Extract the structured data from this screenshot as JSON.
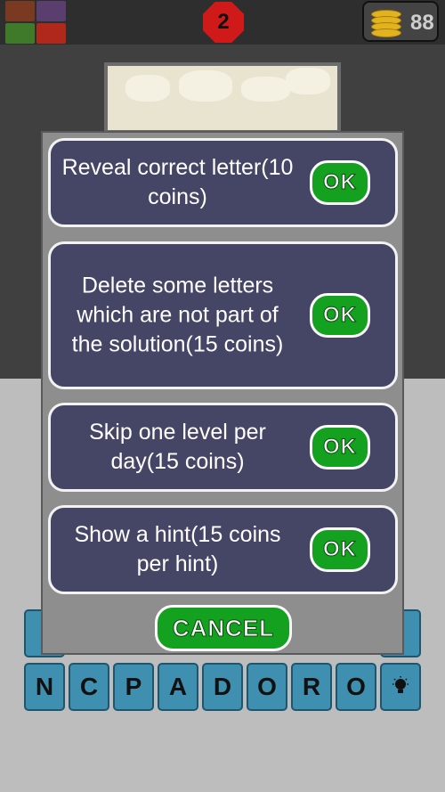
{
  "header": {
    "level": "2",
    "coins": "88"
  },
  "modal": {
    "options": [
      {
        "label": "Reveal correct letter(10 coins)",
        "button": "OK"
      },
      {
        "label": "Delete some letters which are not part of the solution(15 coins)",
        "button": "OK"
      },
      {
        "label": "Skip one level per day(15 coins)",
        "button": "OK"
      },
      {
        "label": "Show a hint(15 coins per hint)",
        "button": "OK"
      }
    ],
    "cancel": "CANCEL"
  },
  "letters": [
    "N",
    "C",
    "P",
    "A",
    "D",
    "O",
    "R",
    "O"
  ],
  "hint_icon": "lightbulb-icon",
  "colors": {
    "option_bg": "#454665",
    "button_green": "#14a11f",
    "level_badge": "#d01a1a",
    "coin_gold": "#e2b21f",
    "tile_blue": "#3f8fb0"
  }
}
